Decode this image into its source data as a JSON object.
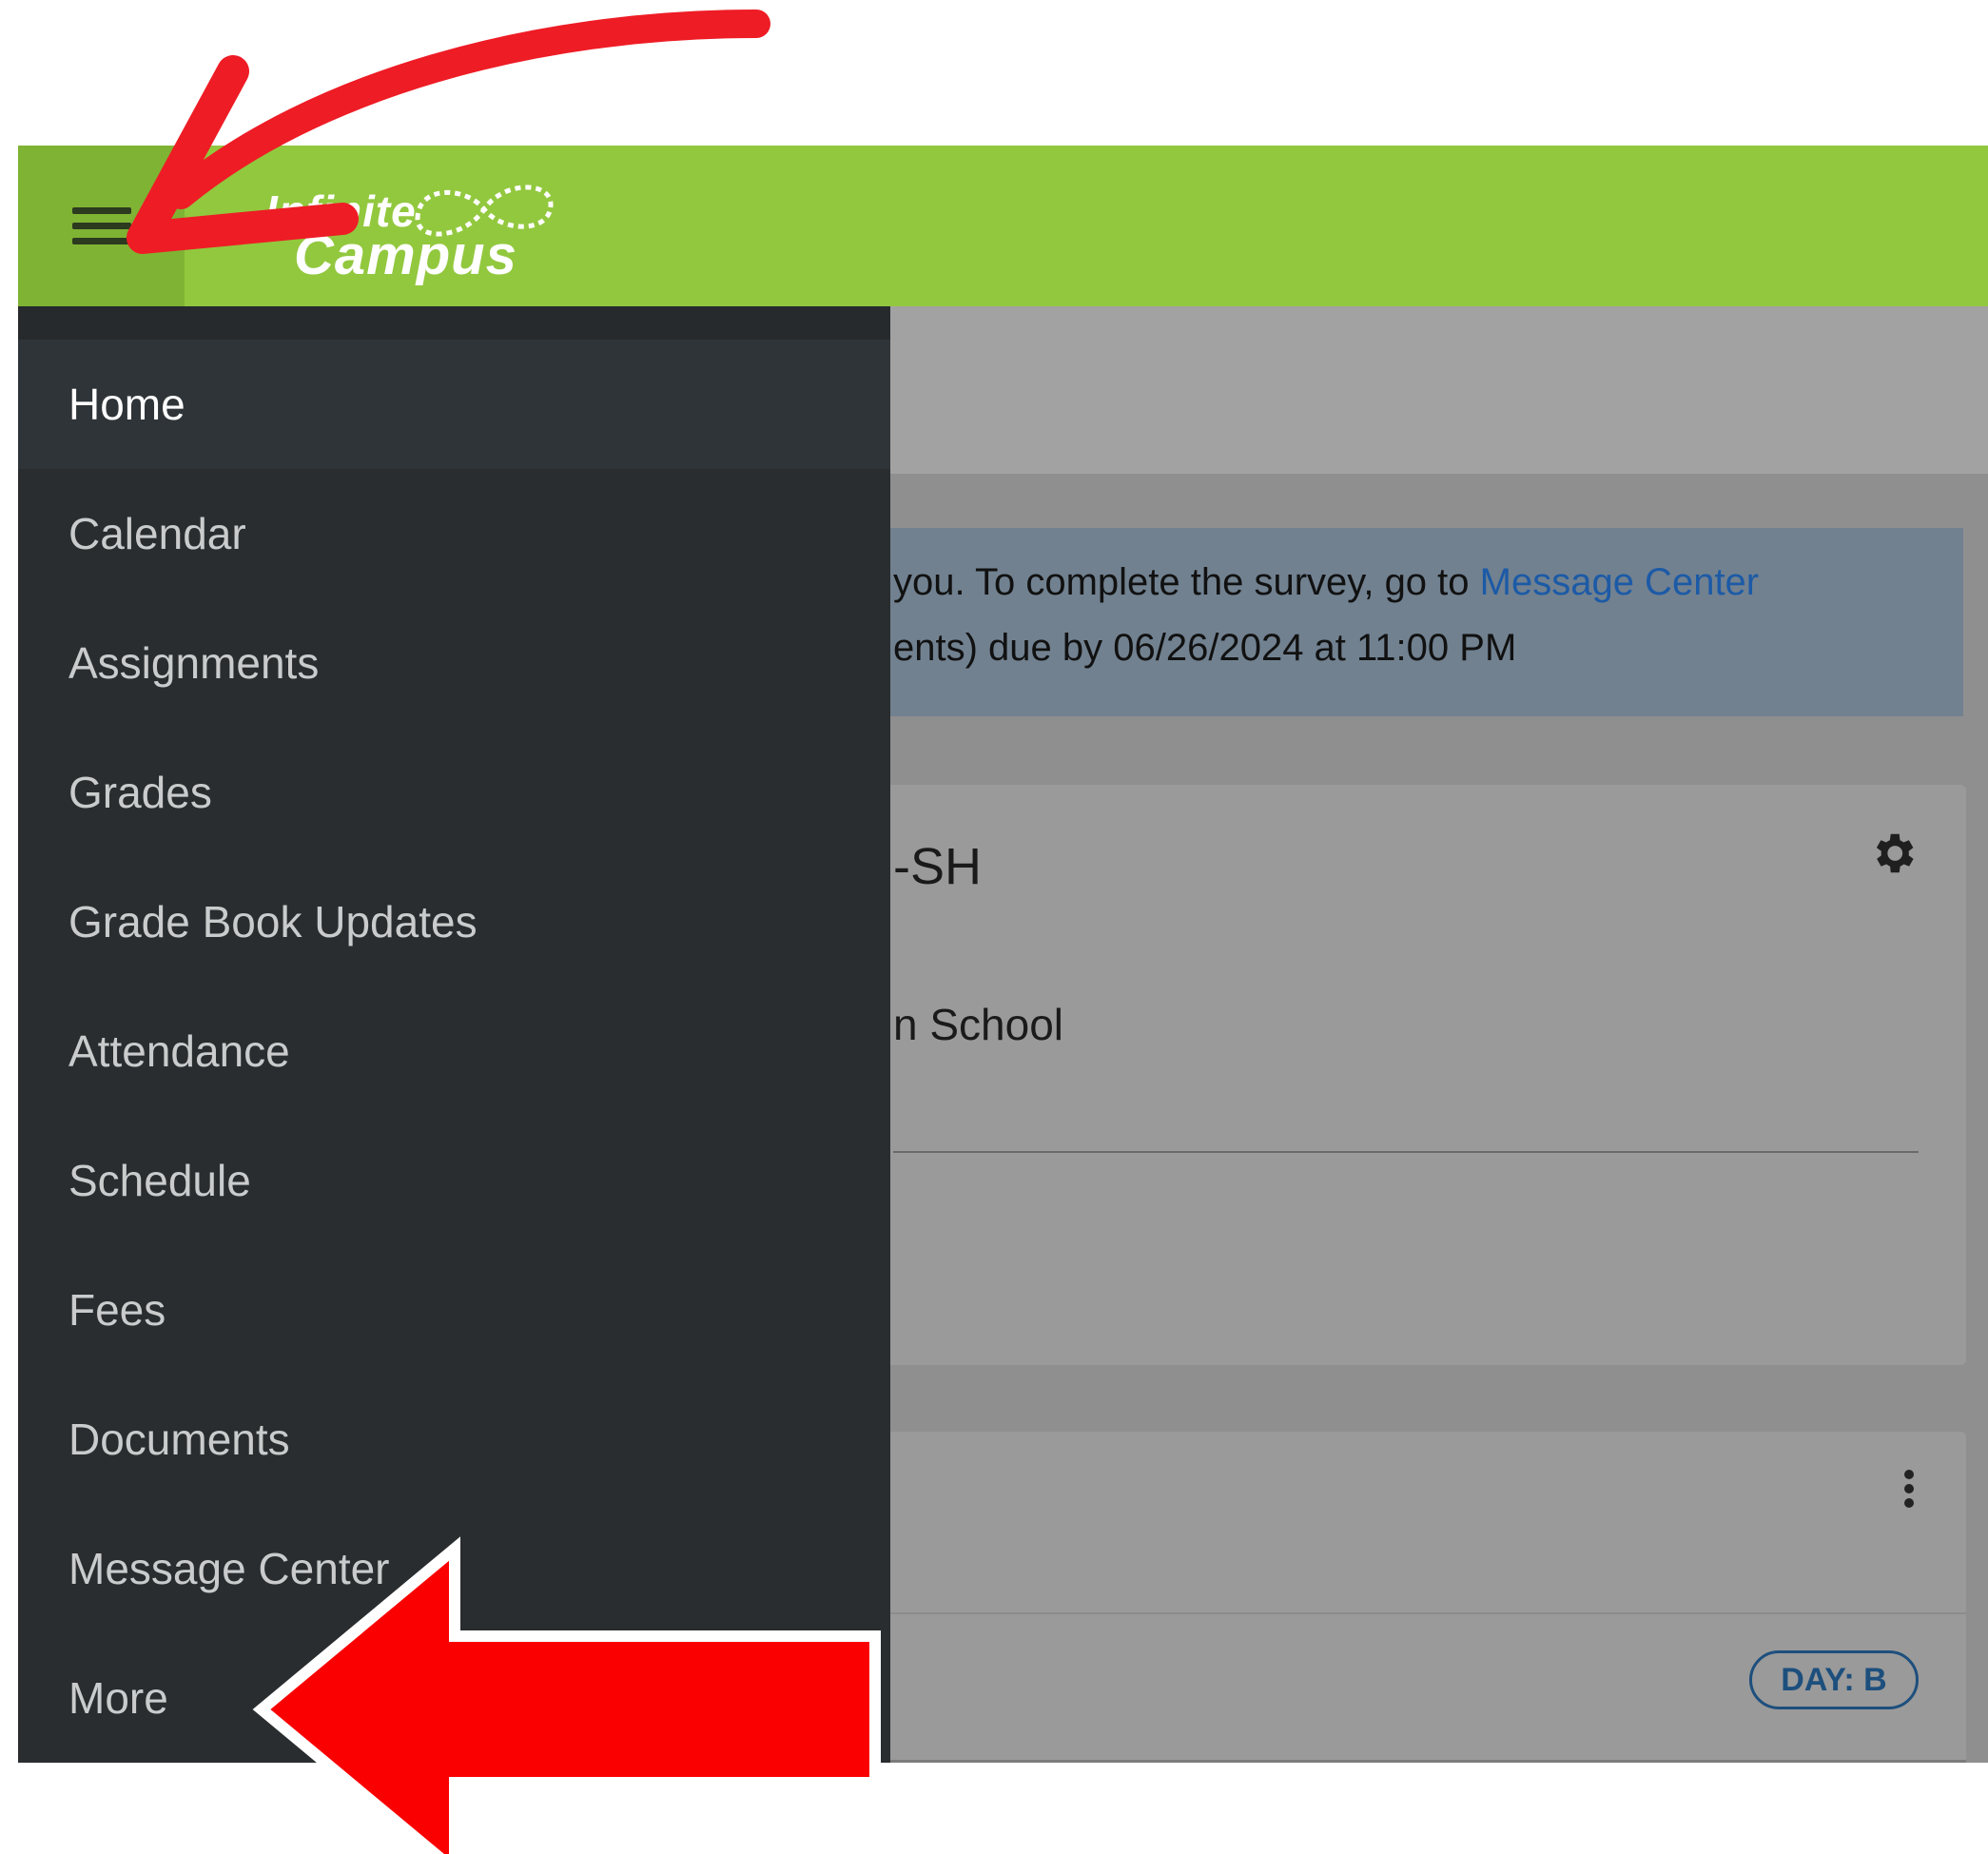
{
  "header": {
    "logo_line1": "Infinite",
    "logo_line2": "Campus",
    "brand_color": "#92c83e"
  },
  "sidebar": {
    "items": [
      {
        "label": "Home",
        "active": true
      },
      {
        "label": "Calendar"
      },
      {
        "label": "Assignments"
      },
      {
        "label": "Grades"
      },
      {
        "label": "Grade Book Updates"
      },
      {
        "label": "Attendance"
      },
      {
        "label": "Schedule"
      },
      {
        "label": "Fees"
      },
      {
        "label": "Documents"
      },
      {
        "label": "Message Center"
      },
      {
        "label": "More"
      }
    ]
  },
  "alert": {
    "line1_prefix": "you. To complete the survey, go to ",
    "line1_link": "Message Center",
    "line2": "ents) due by 06/26/2024 at 11:00 PM"
  },
  "card1": {
    "title": "-SH",
    "subtitle": "n School"
  },
  "card2": {
    "day_badge": "DAY: B"
  },
  "annotation_color": "#ee1c25"
}
